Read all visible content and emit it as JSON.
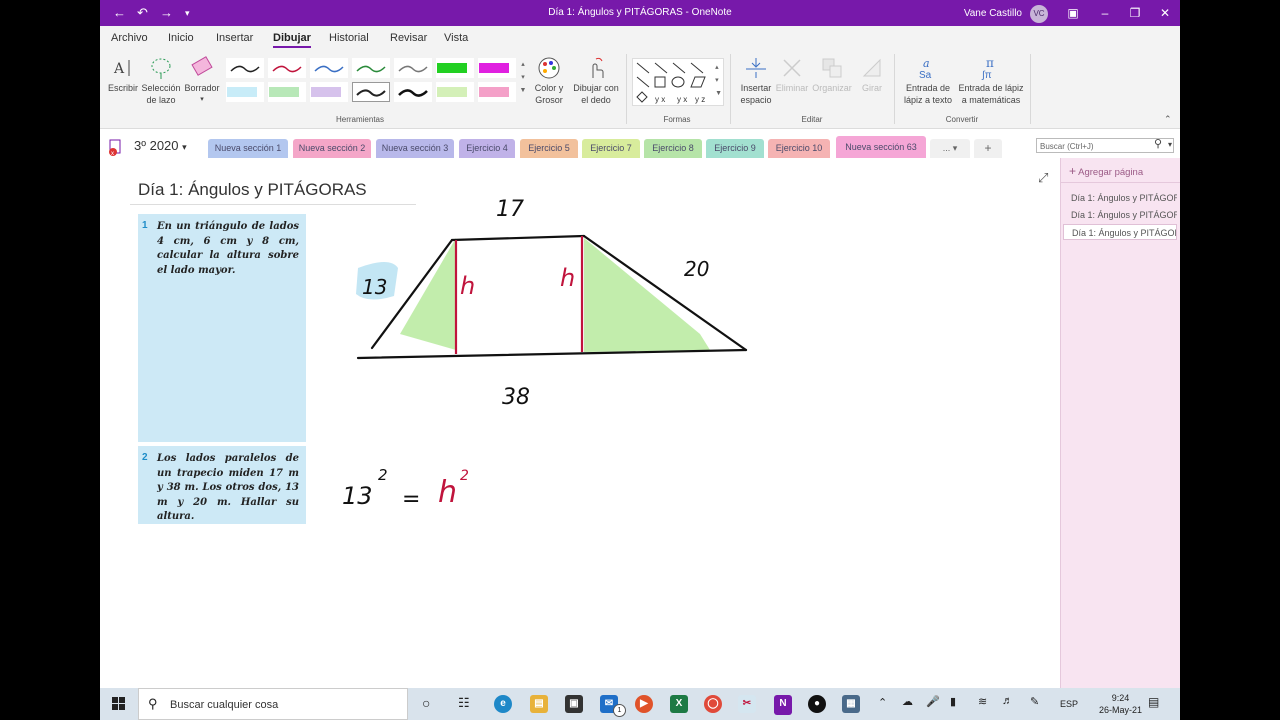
{
  "window": {
    "title": "Día 1: Ángulos y PITÁGORAS  -  OneNote",
    "user_name": "Vane Castillo",
    "user_initials": "VC"
  },
  "ribbon_tabs": [
    "Archivo",
    "Inicio",
    "Insertar",
    "Dibujar",
    "Historial",
    "Revisar",
    "Vista"
  ],
  "ribbon": {
    "write": "Escribir",
    "lasso": "Selección de lazo",
    "eraser": "Borrador",
    "color_thickness": "Color y Grosor",
    "draw_finger": "Dibujar con el dedo",
    "insert_space": "Insertar espacio",
    "delete": "Eliminar",
    "arrange": "Organizar",
    "rotate": "Girar",
    "ink_to_text": "Entrada de lápiz a texto",
    "ink_to_math": "Entrada de lápiz a matemáticas",
    "groups": {
      "tools": "Herramientas",
      "shapes": "Formas",
      "edit": "Editar",
      "convert": "Convertir"
    }
  },
  "notebook": {
    "name": "3º 2020"
  },
  "section_tabs": [
    {
      "label": "Nueva sección 1",
      "color": "#b3c7ef"
    },
    {
      "label": "Nueva sección 2",
      "color": "#f4a6c8"
    },
    {
      "label": "Nueva sección 3",
      "color": "#b8b8ea"
    },
    {
      "label": "Ejercicio 4",
      "color": "#c0b2e8"
    },
    {
      "label": "Ejercicio 5",
      "color": "#f2c19c"
    },
    {
      "label": "Ejercicio 7",
      "color": "#d8ec9c"
    },
    {
      "label": "Ejercicio 8",
      "color": "#b6e4a8"
    },
    {
      "label": "Ejercicio 9",
      "color": "#a2e0d0"
    },
    {
      "label": "Ejercicio 10",
      "color": "#f5b3b3"
    },
    {
      "label": "Nueva sección 63",
      "color": "#f5a6d6"
    }
  ],
  "search": {
    "placeholder": "Buscar (Ctrl+J)"
  },
  "page": {
    "title": "Día 1: Ángulos y PITÁGORAS",
    "problems": [
      {
        "number": "1",
        "text": "En un triángulo de lados 4 cm, 6 cm y 8 cm, calcular la altura sobre el lado mayor."
      },
      {
        "number": "2",
        "text": "Los lados paralelos de un trapecio miden 17 m y 38 m. Los otros dos, 13 m y 20 m. Hallar su altura."
      }
    ],
    "ink_labels": {
      "top": "17",
      "left": "13",
      "right": "20",
      "bottom": "38",
      "height_left": "h",
      "height_right": "h",
      "eq_base": "13",
      "eq_exp": "2",
      "eq_sign": "=",
      "eq_h": "h",
      "eq_h_exp": "2"
    }
  },
  "page_list": {
    "add_page": "Agregar página",
    "pages": [
      "Día 1: Ángulos y PITÁGORAS",
      "Día 1: Ángulos y PITÁGORAS",
      "Día 1: Ángulos y PITÁGORAS"
    ]
  },
  "taskbar": {
    "search_placeholder": "Buscar cualquier cosa",
    "language": "ESP",
    "time": "9:24",
    "date": "26-May-21",
    "notification_count": "1"
  },
  "colors": {
    "onenote_purple": "#7719aa",
    "problem_bg": "#cde9f6",
    "highlight_green": "#b7ea9e",
    "ink_red": "#c0143c"
  }
}
